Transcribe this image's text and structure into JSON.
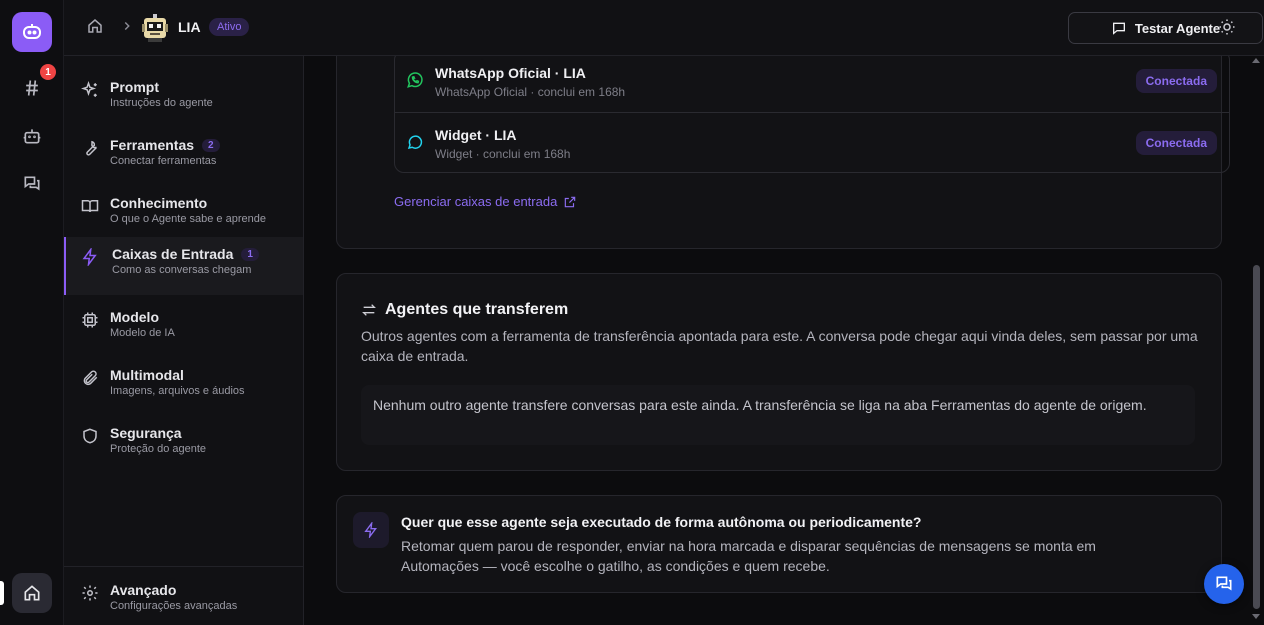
{
  "rail": {
    "notification_count": "1"
  },
  "header": {
    "agent_name": "LIA",
    "status": "Ativo",
    "test_button": "Testar Agente"
  },
  "sidebar": {
    "items": [
      {
        "title": "Prompt",
        "subtitle": "Instruções do agente"
      },
      {
        "title": "Ferramentas",
        "subtitle": "Conectar ferramentas",
        "count": "2"
      },
      {
        "title": "Conhecimento",
        "subtitle": "O que o Agente sabe e aprende"
      },
      {
        "title": "Caixas de Entrada",
        "subtitle": "Como as conversas chegam",
        "count": "1"
      },
      {
        "title": "Modelo",
        "subtitle": "Modelo de IA"
      },
      {
        "title": "Multimodal",
        "subtitle": "Imagens, arquivos e áudios"
      },
      {
        "title": "Segurança",
        "subtitle": "Proteção do agente"
      }
    ],
    "footer": {
      "title": "Avançado",
      "subtitle": "Configurações avançadas"
    }
  },
  "inboxes": {
    "items": [
      {
        "title": "WhatsApp Oficial · LIA",
        "subtitle": "WhatsApp Oficial · conclui em 168h",
        "status": "Conectada",
        "icon": "whatsapp-icon"
      },
      {
        "title": "Widget · LIA",
        "subtitle": "Widget · conclui em 168h",
        "status": "Conectada",
        "icon": "chat-bubble-icon"
      }
    ],
    "manage_link": "Gerenciar caixas de entrada"
  },
  "transfer_section": {
    "title": "Agentes que transferem",
    "description": "Outros agentes com a ferramenta de transferência apontada para este. A conversa pode chegar aqui vinda deles, sem passar por uma caixa de entrada.",
    "empty_message": "Nenhum outro agente transfere conversas para este ainda. A transferência se liga na aba Ferramentas do agente de origem."
  },
  "automation_card": {
    "title": "Quer que esse agente seja executado de forma autônoma ou periodicamente?",
    "description": "Retomar quem parou de responder, enviar na hora marcada e disparar sequências de mensagens se monta em Automações — você escolhe o gatilho, as condições e quem recebe."
  },
  "colors": {
    "accent": "#8b5cf6",
    "whatsapp": "#22c55e",
    "widget": "#22d3ee",
    "fab": "#2563eb",
    "badge": "#ef4444"
  }
}
